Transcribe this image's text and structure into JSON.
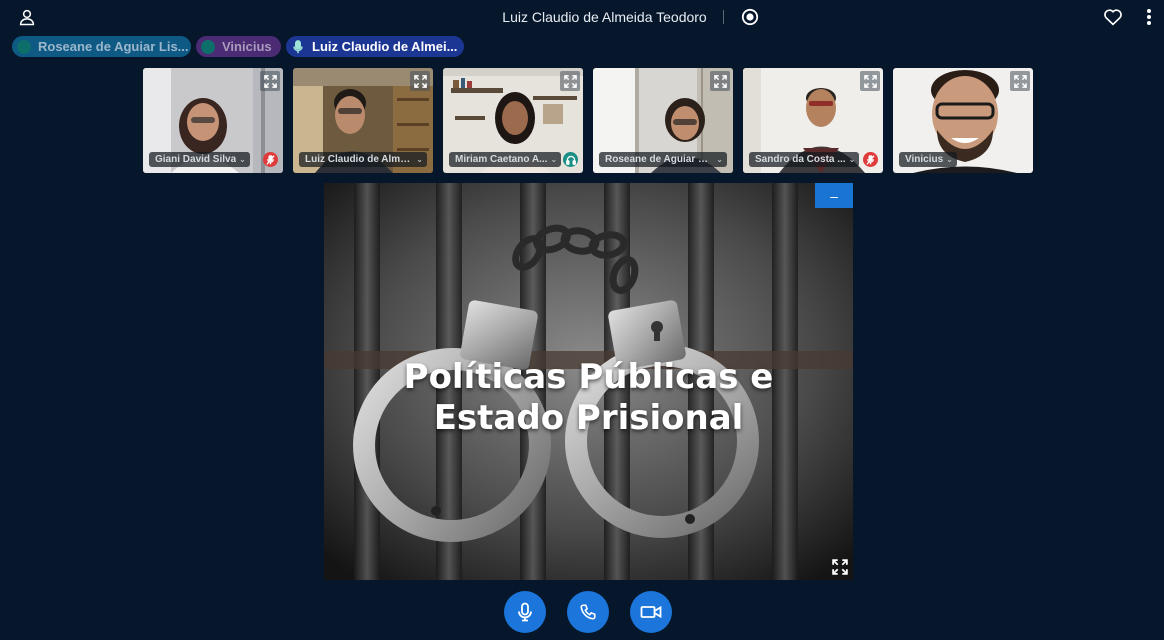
{
  "header": {
    "title": "Luiz Claudio de Almeida Teodoro",
    "icons": {
      "user": "user-icon",
      "record": "record-icon",
      "favorite": "heart-icon",
      "menu": "more-vertical-icon"
    }
  },
  "participants_bar": [
    {
      "name": "Roseane de Aguiar Lis...",
      "color": "#0f5a84"
    },
    {
      "name": "Vinicius",
      "color": "#4a2b74"
    },
    {
      "name": "Luiz Claudio de Almei...",
      "color": "#1c3693",
      "talking": true
    }
  ],
  "videos": [
    {
      "name": "Giani David Silva",
      "status": "muted"
    },
    {
      "name": "Luiz Claudio de Alme...",
      "status": ""
    },
    {
      "name": "Miriam Caetano A...",
      "status": "listen-only"
    },
    {
      "name": "Roseane de Aguiar Li...",
      "status": ""
    },
    {
      "name": "Sandro da Costa ...",
      "status": "muted"
    },
    {
      "name": "Vinicius",
      "status": ""
    }
  ],
  "presentation": {
    "title_line1": "Políticas Públicas e",
    "title_line2": "Estado Prisional",
    "minimize_label": "–"
  },
  "controls": {
    "icons": [
      "microphone-icon",
      "phone-icon",
      "video-camera-icon"
    ],
    "accent": "#1b75db"
  },
  "colors": {
    "background": "#06172b",
    "muted_badge": "#df3b3b",
    "listen_badge": "#1a8f85"
  }
}
